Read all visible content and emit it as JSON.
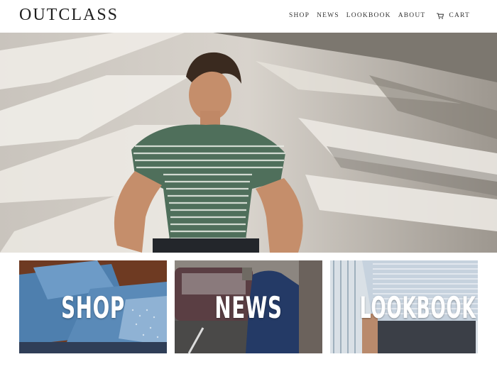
{
  "header": {
    "logo": "OUTCLASS",
    "nav": [
      {
        "label": "SHOP"
      },
      {
        "label": "NEWS"
      },
      {
        "label": "LOOKBOOK"
      },
      {
        "label": "ABOUT"
      }
    ],
    "cart_label": "CART",
    "cart_icon": "cart-icon"
  },
  "hero": {
    "image": "man in green striped shirt sitting on sunlit floor",
    "colors": {
      "floor_light": "#e8e4dd",
      "floor_shadow": "#8a857e",
      "shirt": "#4a6b55"
    }
  },
  "tiles": [
    {
      "label": "SHOP",
      "image": "folded blue printed shirts"
    },
    {
      "label": "NEWS",
      "image": "man in navy jacket on street"
    },
    {
      "label": "LOOKBOOK",
      "image": "man in striped shirt and dark jeans"
    }
  ]
}
